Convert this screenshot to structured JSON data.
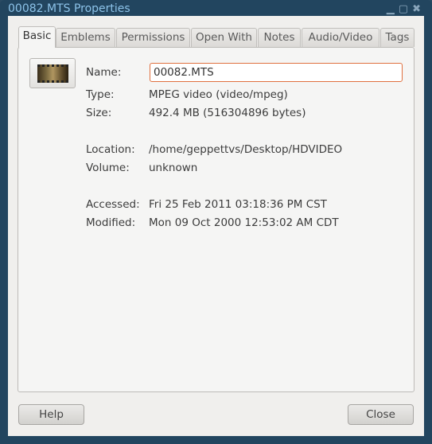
{
  "window": {
    "title": "00082.MTS Properties",
    "controls": [
      "minimize",
      "maximize",
      "close"
    ]
  },
  "tabs": [
    {
      "label": "Basic",
      "active": true
    },
    {
      "label": "Emblems"
    },
    {
      "label": "Permissions"
    },
    {
      "label": "Open With"
    },
    {
      "label": "Notes"
    },
    {
      "label": "Audio/Video"
    },
    {
      "label": "Tags"
    }
  ],
  "basic": {
    "name_label": "Name:",
    "name_value": "00082.MTS",
    "type_label": "Type:",
    "type_value": "MPEG video (video/mpeg)",
    "size_label": "Size:",
    "size_value": "492.4 MB (516304896 bytes)",
    "location_label": "Location:",
    "location_value": "/home/geppettvs/Desktop/HDVIDEO",
    "volume_label": "Volume:",
    "volume_value": "unknown",
    "accessed_label": "Accessed:",
    "accessed_value": "Fri 25 Feb 2011 03:18:36 PM CST",
    "modified_label": "Modified:",
    "modified_value": "Mon 09 Oct 2000 12:53:02 AM CDT"
  },
  "buttons": {
    "help": "Help",
    "close": "Close"
  }
}
